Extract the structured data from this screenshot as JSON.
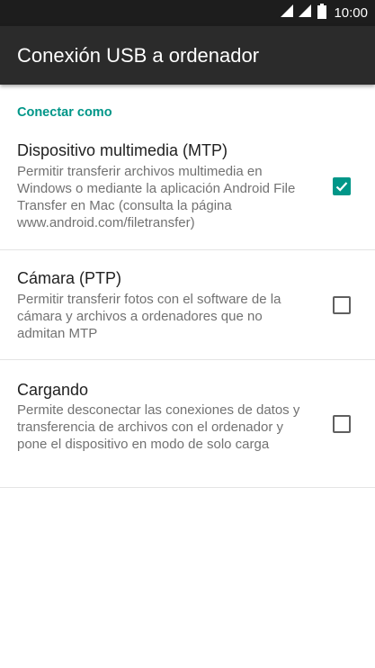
{
  "status_bar": {
    "time": "10:00",
    "icons": [
      "signal-icon",
      "signal-icon",
      "battery-icon"
    ]
  },
  "app_bar": {
    "title": "Conexión USB a ordenador"
  },
  "section": {
    "header": "Conectar como"
  },
  "options": [
    {
      "title": "Dispositivo multimedia (MTP)",
      "summary": "Permitir transferir archivos multimedia en Windows o mediante la aplicación Android File Transfer en Mac (consulta la página www.android.com/filetransfer)",
      "checked": true
    },
    {
      "title": "Cámara (PTP)",
      "summary": "Permitir transferir fotos con el software de la cámara y archivos a ordenadores que no admitan MTP",
      "checked": false
    },
    {
      "title": "Cargando",
      "summary": "Permite desconectar las conexiones de datos y transferencia de archivos con el ordenador y pone el dispositivo en modo de solo carga",
      "checked": false
    }
  ],
  "colors": {
    "accent": "#009688",
    "app_bar": "#2b2b2b",
    "status_bar": "#1d1d1d"
  }
}
